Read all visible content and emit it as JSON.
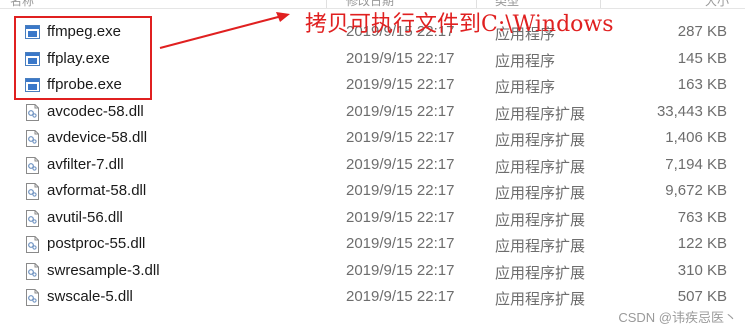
{
  "header": {
    "col_name": "名称",
    "col_date": "修改日期",
    "col_type": "类型",
    "col_size": "大小"
  },
  "files": [
    {
      "name": "ffmpeg.exe",
      "date": "2019/9/15 22:17",
      "type": "应用程序",
      "size": "287 KB",
      "icon": "exe-icon"
    },
    {
      "name": "ffplay.exe",
      "date": "2019/9/15 22:17",
      "type": "应用程序",
      "size": "145 KB",
      "icon": "exe-icon"
    },
    {
      "name": "ffprobe.exe",
      "date": "2019/9/15 22:17",
      "type": "应用程序",
      "size": "163 KB",
      "icon": "exe-icon"
    },
    {
      "name": "avcodec-58.dll",
      "date": "2019/9/15 22:17",
      "type": "应用程序扩展",
      "size": "33,443 KB",
      "icon": "dll-icon"
    },
    {
      "name": "avdevice-58.dll",
      "date": "2019/9/15 22:17",
      "type": "应用程序扩展",
      "size": "1,406 KB",
      "icon": "dll-icon"
    },
    {
      "name": "avfilter-7.dll",
      "date": "2019/9/15 22:17",
      "type": "应用程序扩展",
      "size": "7,194 KB",
      "icon": "dll-icon"
    },
    {
      "name": "avformat-58.dll",
      "date": "2019/9/15 22:17",
      "type": "应用程序扩展",
      "size": "9,672 KB",
      "icon": "dll-icon"
    },
    {
      "name": "avutil-56.dll",
      "date": "2019/9/15 22:17",
      "type": "应用程序扩展",
      "size": "763 KB",
      "icon": "dll-icon"
    },
    {
      "name": "postproc-55.dll",
      "date": "2019/9/15 22:17",
      "type": "应用程序扩展",
      "size": "122 KB",
      "icon": "dll-icon"
    },
    {
      "name": "swresample-3.dll",
      "date": "2019/9/15 22:17",
      "type": "应用程序扩展",
      "size": "310 KB",
      "icon": "dll-icon"
    },
    {
      "name": "swscale-5.dll",
      "date": "2019/9/15 22:17",
      "type": "应用程序扩展",
      "size": "507 KB",
      "icon": "dll-icon"
    }
  ],
  "annotation": {
    "text": "拷贝可执行文件到C:\\Windows",
    "color": "#e02020"
  },
  "watermark": "CSDN @讳疾忌医丶"
}
